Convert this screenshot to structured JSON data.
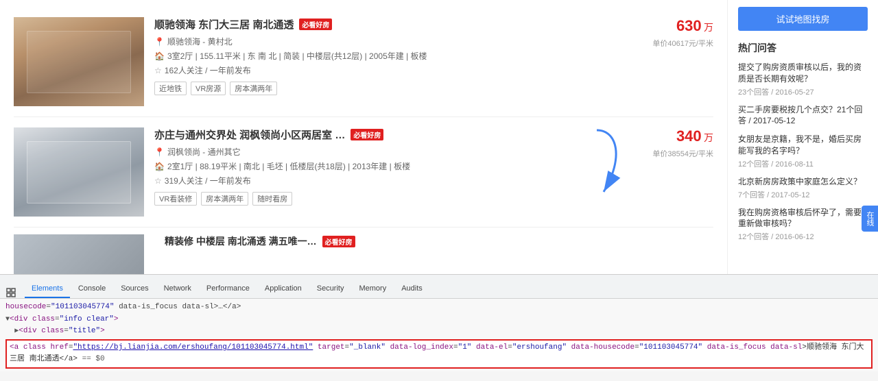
{
  "browser": {
    "devtools": {
      "tabs": [
        {
          "id": "elements",
          "label": "Elements",
          "active": true
        },
        {
          "id": "console",
          "label": "Console",
          "active": false
        },
        {
          "id": "sources",
          "label": "Sources",
          "active": false
        },
        {
          "id": "network",
          "label": "Network",
          "active": false
        },
        {
          "id": "performance",
          "label": "Performance",
          "active": false
        },
        {
          "id": "application",
          "label": "Application",
          "active": false
        },
        {
          "id": "security",
          "label": "Security",
          "active": false
        },
        {
          "id": "memory",
          "label": "Memory",
          "active": false
        },
        {
          "id": "audits",
          "label": "Audits",
          "active": false
        }
      ],
      "dom_lines": [
        "housecode=\"101103045774\" data-is_focus data-sl>…</a>",
        "▼<div class=\"info clear\">",
        "  ▶<div class=\"title\">"
      ],
      "selected_line": "<a class href=\"https://bj.lianjia.com/ershoufang/101103045774.html\" target=\"_blank\" data-log_index=\"1\" data-el=\"ershoufang\" data-housecode=\"101103045774\" data-is_focus data-sl>顺驰领海 东门大三居 南北通透</a> == $0"
    }
  },
  "listings": [
    {
      "id": 1,
      "title": "顺驰领海 东门大三居 南北通透",
      "tag": "必看好房",
      "tag_type": "red",
      "location": "顺驰领海 - 黄村北",
      "details": "3室2厅 | 155.11平米 | 东 南 北 | 简装 | 中楼层(共12层) | 2005年建 | 板楼",
      "stats": "162人关注 / 一年前发布",
      "tags": [
        "近地铁",
        "VR房源",
        "房本满两年"
      ],
      "price": "630",
      "price_unit": "万",
      "price_per": "单价40617元/平米",
      "img_bg": "#b8a898"
    },
    {
      "id": 2,
      "title": "亦庄与通州交界处 润枫领尚小区两居室 …",
      "tag": "必看好房",
      "tag_type": "red",
      "location": "润枫领尚 - 通州其它",
      "details": "2室1厅 | 88.19平米 | 南北 | 毛坯 | 低楼层(共18层) | 2013年建 | 板楼",
      "stats": "319人关注 / 一年前发布",
      "tags": [
        "VR看装修",
        "房本满两年",
        "随时看房"
      ],
      "price": "340",
      "price_unit": "万",
      "price_per": "单价38554元/平米",
      "img_bg": "#c8ccd0"
    },
    {
      "id": 3,
      "title": "精装修 中楼层 南北涌透 满五唯一…",
      "tag": "必看好房",
      "tag_type": "red",
      "price": "",
      "price_unit": "",
      "price_per": ""
    }
  ],
  "sidebar": {
    "btn_label": "试试地图找房",
    "section_title": "热门问答",
    "qa_items": [
      {
        "title": "提交了购房资质审核以后，我的资质是否长期有效呢？",
        "meta": "23个回答 / 2016-05-27"
      },
      {
        "title": "买二手房要税按几个点交？21个回答 / 2017-05-12",
        "meta": ""
      },
      {
        "title": "女朋友是京籍，我不是，婚后买房能写我的名字吗？",
        "meta": "12个回答 / 2016-08-11"
      },
      {
        "title": "北京新房房政策中家庭怎么定义？",
        "meta": "7个回答 / 2017-05-12"
      },
      {
        "title": "我在购房资格审核后怀孕了，需要重新做审核吗？",
        "meta": "12个回答 / 2016-06-12"
      }
    ]
  },
  "chat_widget": "在线",
  "colors": {
    "accent_blue": "#4285f4",
    "price_red": "#e02020",
    "tag_red": "#e02020",
    "devtools_blue": "#1a73e8"
  }
}
